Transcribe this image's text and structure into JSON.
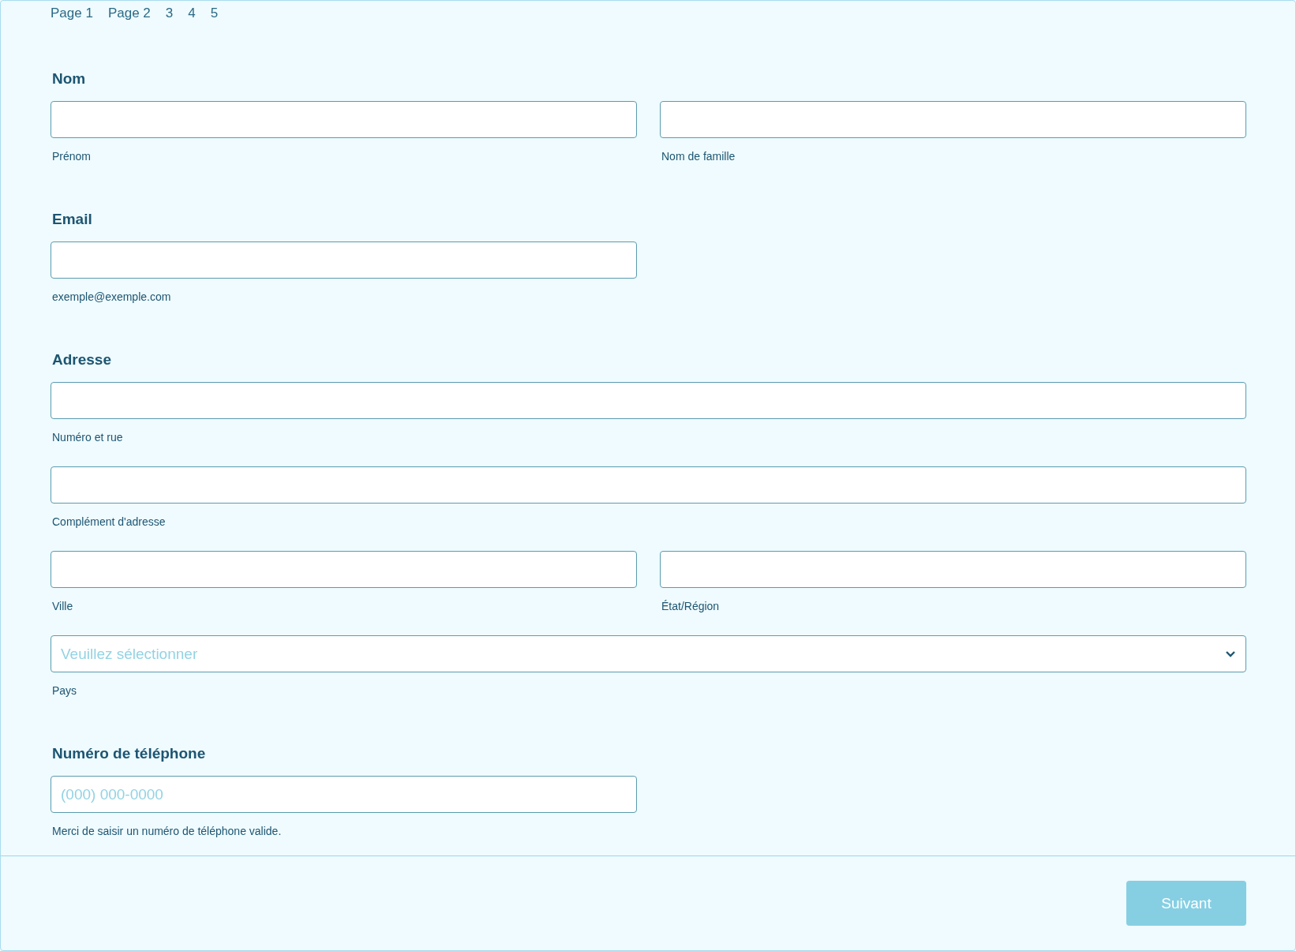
{
  "pagination": [
    {
      "label": "Page 1"
    },
    {
      "label": "Page 2"
    },
    {
      "label": "3"
    },
    {
      "label": "4"
    },
    {
      "label": "5"
    }
  ],
  "sections": [
    {
      "label": "Nom",
      "rows": [
        [
          {
            "kind": "text",
            "sublabel": "Prénom"
          },
          {
            "kind": "text",
            "sublabel": "Nom de famille"
          }
        ]
      ]
    },
    {
      "label": "Email",
      "rows": [
        [
          {
            "kind": "text",
            "sublabel": "exemple@exemple.com"
          }
        ]
      ]
    },
    {
      "label": "Adresse",
      "rows": [
        [
          {
            "kind": "wide-text",
            "sublabel": "Numéro et rue"
          }
        ],
        [
          {
            "kind": "wide-text",
            "sublabel": "Complément d'adresse"
          }
        ],
        [
          {
            "kind": "text",
            "sublabel": "Ville"
          },
          {
            "kind": "text",
            "sublabel": "État/Région"
          }
        ],
        [
          {
            "kind": "select",
            "placeholder": "Veuillez sélectionner",
            "sublabel": "Pays"
          }
        ]
      ]
    },
    {
      "label": "Numéro de téléphone",
      "rows": [
        [
          {
            "kind": "text",
            "placeholder": "(000) 000-0000",
            "sublabel": "Merci de saisir un numéro de téléphone valide."
          }
        ]
      ]
    }
  ],
  "next_button": {
    "label": "Suivant",
    "disabled": true
  }
}
